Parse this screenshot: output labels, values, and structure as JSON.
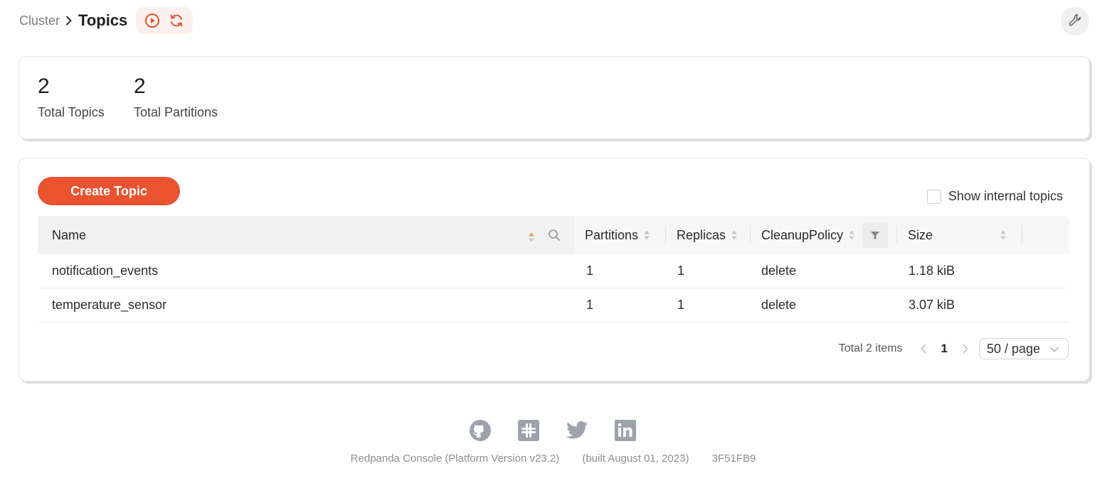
{
  "breadcrumb": {
    "parent": "Cluster",
    "title": "Topics"
  },
  "stats": [
    {
      "value": "2",
      "label": "Total Topics"
    },
    {
      "value": "2",
      "label": "Total Partitions"
    }
  ],
  "toolbar": {
    "create_label": "Create Topic",
    "show_internal_label": "Show internal topics",
    "show_internal_checked": false
  },
  "table": {
    "columns": [
      "Name",
      "Partitions",
      "Replicas",
      "CleanupPolicy",
      "Size"
    ],
    "rows": [
      {
        "name": "notification_events",
        "partitions": "1",
        "replicas": "1",
        "cleanup": "delete",
        "size": "1.18 kiB"
      },
      {
        "name": "temperature_sensor",
        "partitions": "1",
        "replicas": "1",
        "cleanup": "delete",
        "size": "3.07 kiB"
      }
    ]
  },
  "pagination": {
    "total": "Total 2 items",
    "current": "1",
    "page_size": "50 / page"
  },
  "footer": {
    "icons": [
      "github-icon",
      "slack-icon",
      "twitter-icon",
      "linkedin-icon"
    ],
    "version": "Redpanda Console (Platform Version v23.2)",
    "built": "(built August 01, 2023)",
    "commit": "3F51FB9"
  },
  "colors": {
    "accent": "#e9532f",
    "accent_soft": "#fdf1ee",
    "footer_icon": "#9ea3ab"
  }
}
